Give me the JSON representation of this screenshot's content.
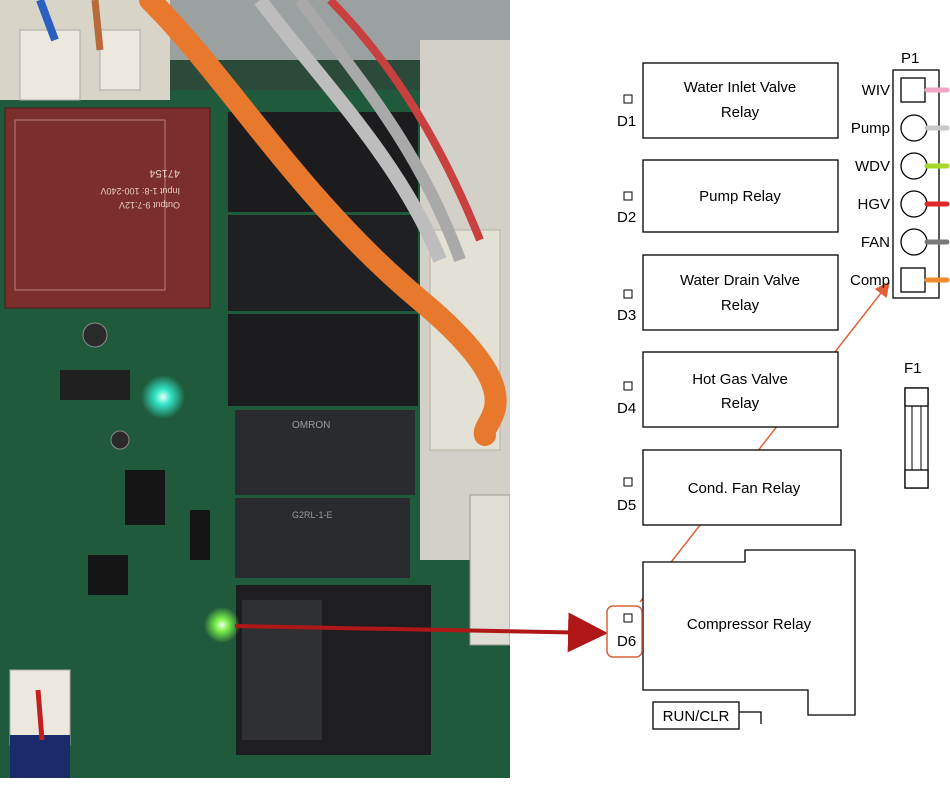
{
  "connector": {
    "title": "P1",
    "pins": [
      {
        "label": "WIV",
        "wire_color": "#f2a6c6",
        "shape": "square"
      },
      {
        "label": "Pump",
        "wire_color": "#c8c8c8",
        "shape": "round"
      },
      {
        "label": "WDV",
        "wire_color": "#a6d82a",
        "shape": "round"
      },
      {
        "label": "HGV",
        "wire_color": "#e02828",
        "shape": "round"
      },
      {
        "label": "FAN",
        "wire_color": "#7a7a7a",
        "shape": "round"
      },
      {
        "label": "Comp",
        "wire_color": "#f08a2c",
        "shape": "square"
      }
    ]
  },
  "relays": [
    {
      "led": "D1",
      "name_line1": "Water Inlet Valve",
      "name_line2": "Relay"
    },
    {
      "led": "D2",
      "name_line1": "Pump Relay",
      "name_line2": ""
    },
    {
      "led": "D3",
      "name_line1": "Water Drain Valve",
      "name_line2": "Relay"
    },
    {
      "led": "D4",
      "name_line1": "Hot Gas Valve",
      "name_line2": "Relay"
    },
    {
      "led": "D5",
      "name_line1": "Cond. Fan Relay",
      "name_line2": ""
    },
    {
      "led": "D6",
      "name_line1": "Compressor Relay",
      "name_line2": ""
    }
  ],
  "fuse": {
    "label": "F1"
  },
  "switch": {
    "label": "RUN/CLR"
  },
  "colors": {
    "pointer_arrow": "#b01818",
    "highlight_box": "#d8603a",
    "compressor_link": "#e0603a",
    "pcb_green": "#1f5a3c"
  },
  "photo": {
    "board_marking_1": "47154",
    "board_marking_2": "Input 1-8: 100-240V",
    "board_marking_3": "Output 9-7:12V",
    "relay_brand": "OMRON",
    "relay_model": "G2RL-1-E"
  }
}
